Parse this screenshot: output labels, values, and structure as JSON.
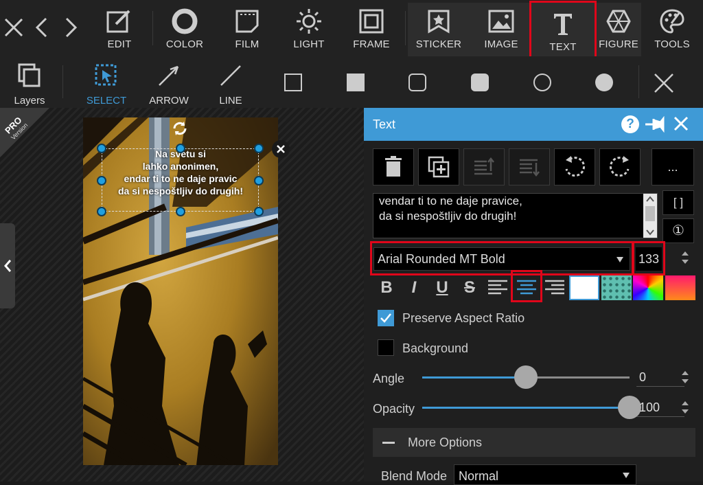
{
  "toolbar": {
    "tools": [
      {
        "label": "EDIT",
        "icon": "edit-icon"
      },
      {
        "label": "COLOR",
        "icon": "color-icon"
      },
      {
        "label": "FILM",
        "icon": "film-icon"
      },
      {
        "label": "LIGHT",
        "icon": "light-icon"
      },
      {
        "label": "FRAME",
        "icon": "frame-icon"
      },
      {
        "label": "STICKER",
        "icon": "sticker-icon"
      },
      {
        "label": "IMAGE",
        "icon": "image-icon"
      },
      {
        "label": "TEXT",
        "icon": "text-icon"
      },
      {
        "label": "FIGURE",
        "icon": "figure-icon"
      },
      {
        "label": "TOOLS",
        "icon": "tools-icon"
      }
    ]
  },
  "shapebar": {
    "layers": "Layers",
    "select": "SELECT",
    "arrow": "ARROW",
    "line": "LINE"
  },
  "badge": {
    "pro": "PRO",
    "version": "Version"
  },
  "canvas": {
    "overlay_lines": [
      "Na svetu si",
      "lahko anonimen,",
      "endar ti to ne daje pravic",
      "da si nespoštljiv do drugih!"
    ]
  },
  "panel": {
    "title": "Text",
    "text_lines": [
      "vendar ti to ne daje pravice,",
      "da si nespoštljiv do drugih!"
    ],
    "more_label": "...",
    "bracket_label": "[ ]",
    "circled_one": "①",
    "font": "Arial Rounded MT Bold",
    "font_size": "133",
    "bold": "B",
    "italic": "I",
    "underline": "U",
    "strike": "S",
    "preserve_aspect": "Preserve Aspect Ratio",
    "background": "Background",
    "angle_label": "Angle",
    "angle_value": "0",
    "angle_level": 0.5,
    "opacity_label": "Opacity",
    "opacity_value": "100",
    "opacity_level": 1.0,
    "more_options": "More Options",
    "blend_label": "Blend Mode",
    "blend_value": "Normal"
  },
  "colors": {
    "accent": "#3f9ad6",
    "highlight": "#e0061a"
  }
}
